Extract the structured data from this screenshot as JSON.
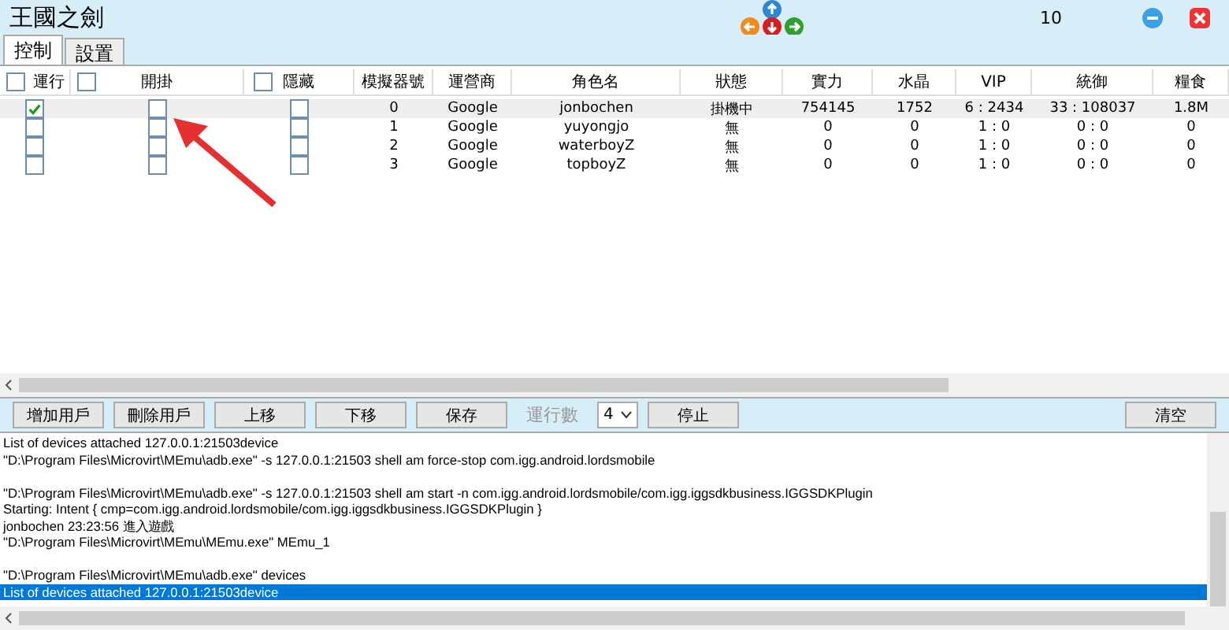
{
  "window": {
    "title": "王國之劍",
    "counter": "10"
  },
  "tabs": [
    {
      "label": "控制",
      "selected": true
    },
    {
      "label": "設置",
      "selected": false
    }
  ],
  "table": {
    "columns": [
      {
        "label": "運行",
        "kind": "check",
        "checked": false
      },
      {
        "label": "開掛",
        "kind": "check",
        "checked": false
      },
      {
        "label": "隱藏",
        "kind": "check",
        "checked": false
      },
      {
        "label": "模擬器號",
        "kind": "text"
      },
      {
        "label": "運營商",
        "kind": "text"
      },
      {
        "label": "角色名",
        "kind": "text"
      },
      {
        "label": "狀態",
        "kind": "text"
      },
      {
        "label": "實力",
        "kind": "text"
      },
      {
        "label": "水晶",
        "kind": "text"
      },
      {
        "label": "VIP",
        "kind": "text"
      },
      {
        "label": "統御",
        "kind": "text"
      },
      {
        "label": "糧食",
        "kind": "text"
      }
    ],
    "rows": [
      {
        "selected": true,
        "cells": [
          {
            "kind": "check",
            "checked": true
          },
          {
            "kind": "check",
            "checked": false
          },
          {
            "kind": "check",
            "checked": false
          },
          {
            "kind": "text",
            "text": "0"
          },
          {
            "kind": "text",
            "text": "Google"
          },
          {
            "kind": "text",
            "text": "jonbochen"
          },
          {
            "kind": "text",
            "text": "掛機中"
          },
          {
            "kind": "text",
            "text": "754145"
          },
          {
            "kind": "text",
            "text": "1752"
          },
          {
            "kind": "text",
            "text": "6 : 2434"
          },
          {
            "kind": "text",
            "text": "33 : 108037"
          },
          {
            "kind": "text",
            "text": "1.8M"
          }
        ]
      },
      {
        "selected": false,
        "cells": [
          {
            "kind": "check",
            "checked": false
          },
          {
            "kind": "check",
            "checked": false
          },
          {
            "kind": "check",
            "checked": false
          },
          {
            "kind": "text",
            "text": "1"
          },
          {
            "kind": "text",
            "text": "Google"
          },
          {
            "kind": "text",
            "text": "yuyongjo"
          },
          {
            "kind": "text",
            "text": "無"
          },
          {
            "kind": "text",
            "text": "0"
          },
          {
            "kind": "text",
            "text": "0"
          },
          {
            "kind": "text",
            "text": "1 : 0"
          },
          {
            "kind": "text",
            "text": "0 : 0"
          },
          {
            "kind": "text",
            "text": "0"
          }
        ]
      },
      {
        "selected": false,
        "cells": [
          {
            "kind": "check",
            "checked": false
          },
          {
            "kind": "check",
            "checked": false
          },
          {
            "kind": "check",
            "checked": false
          },
          {
            "kind": "text",
            "text": "2"
          },
          {
            "kind": "text",
            "text": "Google"
          },
          {
            "kind": "text",
            "text": "waterboyZ"
          },
          {
            "kind": "text",
            "text": "無"
          },
          {
            "kind": "text",
            "text": "0"
          },
          {
            "kind": "text",
            "text": "0"
          },
          {
            "kind": "text",
            "text": "1 : 0"
          },
          {
            "kind": "text",
            "text": "0 : 0"
          },
          {
            "kind": "text",
            "text": "0"
          }
        ]
      },
      {
        "selected": false,
        "cells": [
          {
            "kind": "check",
            "checked": false
          },
          {
            "kind": "check",
            "checked": false
          },
          {
            "kind": "check",
            "checked": false
          },
          {
            "kind": "text",
            "text": "3"
          },
          {
            "kind": "text",
            "text": "Google"
          },
          {
            "kind": "text",
            "text": "topboyZ"
          },
          {
            "kind": "text",
            "text": "無"
          },
          {
            "kind": "text",
            "text": "0"
          },
          {
            "kind": "text",
            "text": "0"
          },
          {
            "kind": "text",
            "text": "1 : 0"
          },
          {
            "kind": "text",
            "text": "0 : 0"
          },
          {
            "kind": "text",
            "text": "0"
          }
        ]
      }
    ]
  },
  "toolbar": {
    "buttons": [
      "增加用戶",
      "刪除用戶",
      "上移",
      "下移",
      "保存"
    ],
    "run_count": {
      "label": "運行數",
      "disabled": true,
      "value": "4"
    },
    "stop": "停止",
    "clear": "清空"
  },
  "log": [
    {
      "kind": "line",
      "text": "List of devices attached 127.0.0.1:21503device",
      "selected": false
    },
    {
      "kind": "line",
      "text": "\"D:\\Program Files\\Microvirt\\MEmu\\adb.exe\" -s 127.0.0.1:21503 shell am force-stop com.igg.android.lordsmobile",
      "selected": false
    },
    {
      "kind": "blank"
    },
    {
      "kind": "line",
      "text": "\"D:\\Program Files\\Microvirt\\MEmu\\adb.exe\" -s 127.0.0.1:21503 shell am start -n com.igg.android.lordsmobile/com.igg.iggsdkbusiness.IGGSDKPlugin",
      "selected": false
    },
    {
      "kind": "line",
      "text": "Starting: Intent { cmp=com.igg.android.lordsmobile/com.igg.iggsdkbusiness.IGGSDKPlugin }",
      "selected": false
    },
    {
      "kind": "line",
      "text": "jonbochen   23:23:56  進入遊戲",
      "selected": false
    },
    {
      "kind": "line",
      "text": "\"D:\\Program Files\\Microvirt\\MEmu\\MEmu.exe\" MEmu_1",
      "selected": false
    },
    {
      "kind": "blank"
    },
    {
      "kind": "line",
      "text": "\"D:\\Program Files\\Microvirt\\MEmu\\adb.exe\" devices",
      "selected": false
    },
    {
      "kind": "line",
      "text": "List of devices attached 127.0.0.1:21503device",
      "selected": true
    }
  ]
}
